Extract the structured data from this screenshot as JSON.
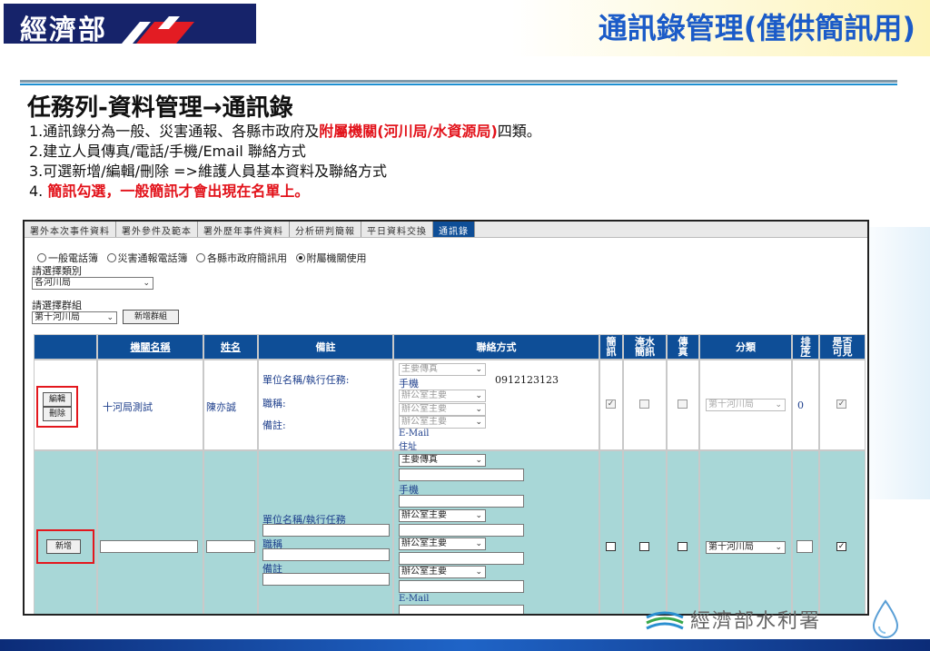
{
  "header": {
    "logo_text": "經濟部",
    "title": "通訊錄管理(僅供簡訊用)"
  },
  "content": {
    "heading": "任務列-資料管理→通訊錄",
    "line1_prefix": "1.通訊錄分為一般、災害通報、各縣市政府及",
    "line1_red": "附屬機關(河川局/水資源局)",
    "line1_suffix": "四類。",
    "line2": "2.建立人員傳真/電話/手機/Email  聯絡方式",
    "line3": "3.可選新增/編輯/刪除 =>維護人員基本資料及聯絡方式",
    "line4_prefix": "4. ",
    "line4_red": "簡訊勾選，一般簡訊才會出現在名單上。"
  },
  "app": {
    "tabs": [
      "署外本次事件資料",
      "署外參件及範本",
      "署外歷年事件資料",
      "分析研判簡報",
      "平日資料交換",
      "通訊錄"
    ],
    "active_tab": 5,
    "radio_options": [
      {
        "label": "一般電話簿",
        "checked": false
      },
      {
        "label": "災害通報電話簿",
        "checked": false
      },
      {
        "label": "各縣市政府簡訊用",
        "checked": false
      },
      {
        "label": "附屬機關使用",
        "checked": true
      }
    ],
    "category_label": "請選擇類別",
    "category_value": "各河川局",
    "group_label": "請選擇群組",
    "group_value": "第十河川局",
    "add_group_button": "新增群組",
    "columns": {
      "agency": "機關名稱",
      "name": "姓名",
      "remarks": "備註",
      "contact": "聯絡方式",
      "sms": "簡訊",
      "flood_sms": "淹水簡訊",
      "fax": "傳真",
      "category": "分類",
      "order": "排序",
      "visible": "是否可見"
    },
    "row": {
      "edit_button": "編輯",
      "delete_button": "刪除",
      "agency": "十河局測試",
      "name": "陳亦誠",
      "unit_label": "單位名稱/執行任務:",
      "title_label": "職稱:",
      "remark_label": "備註:",
      "contact_type1": "主要傳真",
      "mobile_label": "手機",
      "mobile_value": "0912123123",
      "office_main": "辦公室主要",
      "email_label": "E-Mail",
      "address_label": "住址",
      "sms_checked": true,
      "flood_sms_checked": false,
      "fax_checked": false,
      "category": "第十河川局",
      "order": "0",
      "visible_checked": true
    },
    "new_row": {
      "add_button": "新增",
      "unit_label": "單位名稱/執行任務",
      "title_label": "職稱",
      "remark_label": "備註",
      "contact_type1": "主要傳真",
      "mobile_label": "手機",
      "office_main": "辦公室主要",
      "email_label": "E-Mail",
      "category": "第十河川局",
      "sms_checked": false,
      "flood_sms_checked": false,
      "fax_checked": false,
      "visible_checked": true
    }
  },
  "footer": {
    "org_text": "經濟部水利署"
  },
  "colors": {
    "title_blue": "#1b5bc8",
    "header_navy": "#16236a",
    "table_header": "#0e4e97",
    "row_teal": "#a8d7d7",
    "highlight_red": "#e3171d"
  }
}
